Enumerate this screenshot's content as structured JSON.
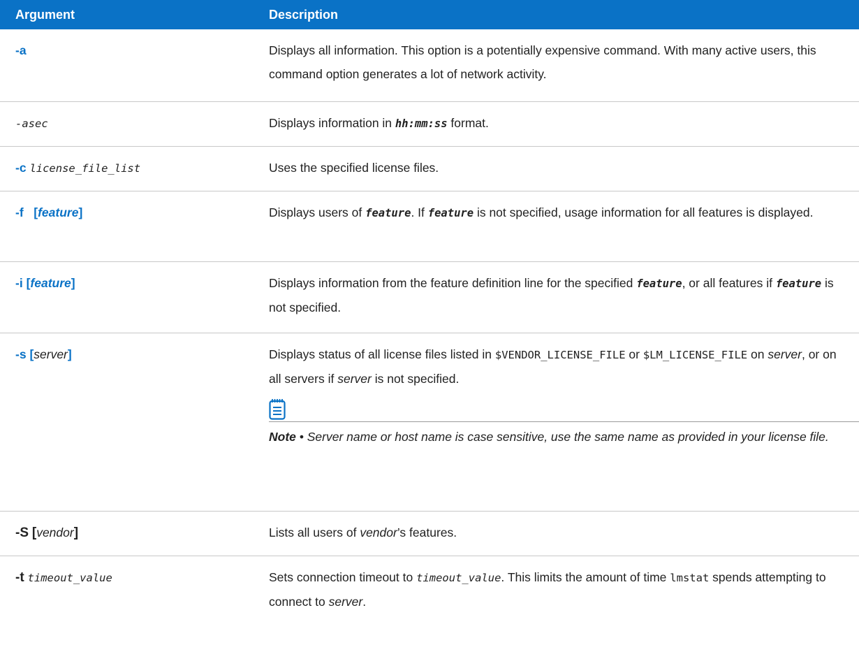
{
  "header": {
    "argument": "Argument",
    "description": "Description"
  },
  "rows": {
    "a": {
      "arg": "-a",
      "desc": "Displays all information. This option is a potentially expensive command. With many active users, this command option generates a lot of network activity."
    },
    "asec": {
      "arg": "-asec",
      "desc_pre": "Displays information in ",
      "desc_code": "hh:mm:ss",
      "desc_post": " format."
    },
    "c": {
      "arg_flag": "-c",
      "arg_param": "license_file_list",
      "desc": "Uses the specified license files."
    },
    "f": {
      "arg_flag": "-f",
      "arg_open": "[",
      "arg_param": "feature",
      "arg_close": "]",
      "desc_1": "Displays users of ",
      "desc_code1": "feature",
      "desc_2": ". If ",
      "desc_code2": "feature",
      "desc_3": " is not specified, usage information for all features is displayed."
    },
    "i": {
      "arg_flag": "-i",
      "arg_open": "[",
      "arg_param": "feature",
      "arg_close": "]",
      "desc_1": "Displays information from the feature definition line for the specified ",
      "desc_code1": "feature",
      "desc_2": ", or all features if ",
      "desc_code2": "feature",
      "desc_3": " is not specified."
    },
    "s": {
      "arg_flag": "-s",
      "arg_open": "[",
      "arg_param": "server",
      "arg_close": "]",
      "desc_1": "Displays status of all license files listed in ",
      "desc_code1": "$VENDOR_LICENSE_FILE",
      "desc_2": " or ",
      "desc_code2": "$LM_LICENSE_FILE",
      "desc_3": " on ",
      "desc_it1": "server",
      "desc_4": ", or on all servers if ",
      "desc_it2": "server",
      "desc_5": " is not specified.",
      "note_label": "Note",
      "note_bullet": " • ",
      "note_text": "Server name or host name is case sensitive, use the same name as provided in your license file."
    },
    "S": {
      "arg_flag": "-S",
      "arg_open": "[",
      "arg_param": "vendor",
      "arg_close": "]",
      "desc_1": "Lists all users of ",
      "desc_it": "vendor",
      "desc_2": "’s features."
    },
    "t": {
      "arg_flag": "-t",
      "arg_param": "timeout_value",
      "desc_1": "Sets connection timeout to ",
      "desc_code1": "timeout_value",
      "desc_2": ". This limits the amount of time ",
      "desc_code2": "lmstat",
      "desc_3": " spends attempting to connect to ",
      "desc_it": "server",
      "desc_4": "."
    }
  },
  "icons": {
    "note": "notepad-icon"
  },
  "colors": {
    "header_bg": "#0a72c6",
    "arg_blue": "#0a72c6"
  }
}
